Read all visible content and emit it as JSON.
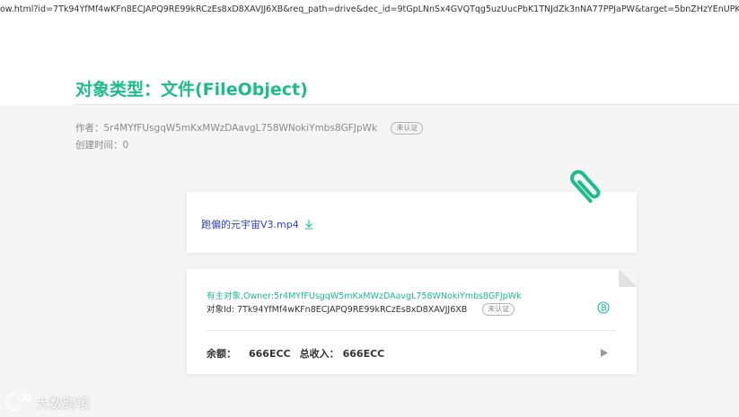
{
  "browser": {
    "url": "ow.html?id=7Tk94YfMf4wKFn8ECJAPQ9RE99kRCzEs8xD8XAVJJ6XB&req_path=drive&dec_id=9tGpLNnSx4GVQTqg5uzUucPbK1TNJdZk3nNA77PPJaPW&target=5bnZHzYEnUPKJkc"
  },
  "header": {
    "title": "对象类型：文件(FileObject)",
    "author_text": "作者：5r4MYfFUsgqW5mKxMWzDAavgL758WNokiYmbs8GFJpWk",
    "author_badge": "未认证",
    "created_time": "创建时间：0"
  },
  "file_card": {
    "file_name": "跑偏的元宇宙V3.mp4",
    "download_icon": "download-icon",
    "attachment_icon": "paperclip-icon"
  },
  "owner_card": {
    "owner_line": "有主对象,Owner:5r4MYfFUsgqW5mKxMWzDAavgL758WNokiYmbs8GFJpWk",
    "object_id_line": "对象Id: 7Tk94YfMf4wKFn8ECJAPQ9RE99kRCzEs8xD8XAVJJ6XB",
    "object_badge": "未认证",
    "coin_icon": "coin-icon",
    "balance_label": "余额：",
    "balance_value": "666ECC",
    "income_label": "总收入：",
    "income_value": "666ECC",
    "expand_icon": "play-icon"
  },
  "watermark": {
    "text": "大数跨境"
  },
  "colors": {
    "accent": "#1dbd8b",
    "link": "#2e3fd6",
    "background": "#f5f5f5"
  }
}
